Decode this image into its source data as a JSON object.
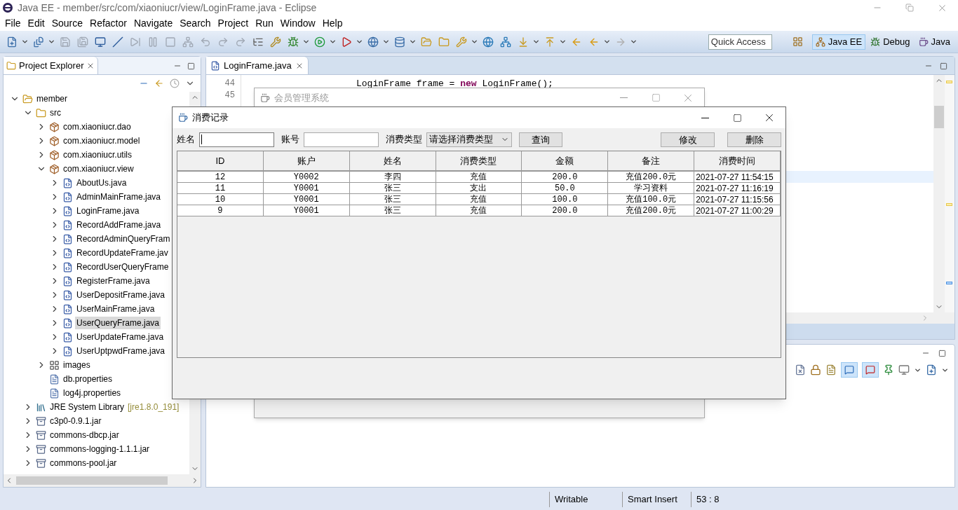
{
  "window": {
    "title": "Java EE - member/src/com/xiaoniucr/view/LoginFrame.java - Eclipse"
  },
  "menu": [
    "File",
    "Edit",
    "Source",
    "Refactor",
    "Navigate",
    "Search",
    "Project",
    "Run",
    "Window",
    "Help"
  ],
  "quick_access": {
    "placeholder": "Quick Access"
  },
  "perspectives": [
    {
      "label": "Java EE",
      "selected": true
    },
    {
      "label": "Debug",
      "selected": false
    },
    {
      "label": "Java",
      "selected": false
    }
  ],
  "project_explorer": {
    "title": "Project Explorer",
    "tree": [
      {
        "label": "member",
        "kind": "project",
        "expanded": true,
        "selected": false,
        "children": [
          {
            "label": "src",
            "kind": "source",
            "expanded": true,
            "selected": false,
            "children": [
              {
                "label": "com.xiaoniucr.dao",
                "kind": "package",
                "expanded": false,
                "selected": false
              },
              {
                "label": "com.xiaoniucr.model",
                "kind": "package",
                "expanded": false,
                "selected": false
              },
              {
                "label": "com.xiaoniucr.utils",
                "kind": "package",
                "expanded": false,
                "selected": false
              },
              {
                "label": "com.xiaoniucr.view",
                "kind": "package",
                "expanded": true,
                "selected": false,
                "children": [
                  {
                    "label": "AboutUs.java",
                    "kind": "java",
                    "expanded": false,
                    "selected": false
                  },
                  {
                    "label": "AdminMainFrame.java",
                    "kind": "java",
                    "expanded": false,
                    "selected": false
                  },
                  {
                    "label": "LoginFrame.java",
                    "kind": "java",
                    "expanded": false,
                    "selected": false
                  },
                  {
                    "label": "RecordAddFrame.java",
                    "kind": "java",
                    "expanded": false,
                    "selected": false
                  },
                  {
                    "label": "RecordAdminQueryFram",
                    "kind": "java",
                    "expanded": false,
                    "selected": false
                  },
                  {
                    "label": "RecordUpdateFrame.jav",
                    "kind": "java",
                    "expanded": false,
                    "selected": false
                  },
                  {
                    "label": "RecordUserQueryFrame",
                    "kind": "java",
                    "expanded": false,
                    "selected": false
                  },
                  {
                    "label": "RegisterFrame.java",
                    "kind": "java",
                    "expanded": false,
                    "selected": false
                  },
                  {
                    "label": "UserDepositFrame.java",
                    "kind": "java",
                    "expanded": false,
                    "selected": false
                  },
                  {
                    "label": "UserMainFrame.java",
                    "kind": "java",
                    "expanded": false,
                    "selected": false
                  },
                  {
                    "label": "UserQueryFrame.java",
                    "kind": "java",
                    "expanded": false,
                    "selected": true
                  },
                  {
                    "label": "UserUpdateFrame.java",
                    "kind": "java",
                    "expanded": false,
                    "selected": false
                  },
                  {
                    "label": "UserUptpwdFrame.java",
                    "kind": "java",
                    "expanded": false,
                    "selected": false
                  }
                ]
              },
              {
                "label": "images",
                "kind": "folder",
                "expanded": false,
                "selected": false
              },
              {
                "label": "db.properties",
                "kind": "properties",
                "selected": false
              },
              {
                "label": "log4j.properties",
                "kind": "properties",
                "selected": false
              }
            ]
          },
          {
            "label": "JRE System Library",
            "decoration": "[jre1.8.0_191]",
            "kind": "library",
            "expanded": false,
            "selected": false
          },
          {
            "label": "c3p0-0.9.1.jar",
            "kind": "jar",
            "expanded": false,
            "selected": false
          },
          {
            "label": "commons-dbcp.jar",
            "kind": "jar",
            "expanded": false,
            "selected": false
          },
          {
            "label": "commons-logging-1.1.1.jar",
            "kind": "jar",
            "expanded": false,
            "selected": false
          },
          {
            "label": "commons-pool.jar",
            "kind": "jar",
            "expanded": false,
            "selected": false
          }
        ]
      }
    ]
  },
  "editor": {
    "tab": "LoginFrame.java",
    "lines": [
      {
        "number": "44",
        "tokens": [
          {
            "text": "LoginFrame frame = ",
            "kind": "plain"
          },
          {
            "text": "new",
            "kind": "keyword"
          },
          {
            "text": " LoginFrame();",
            "kind": "plain"
          }
        ]
      },
      {
        "number": "45"
      }
    ]
  },
  "back_window": {
    "title": "会员管理系统"
  },
  "dialog": {
    "title": "消费记录",
    "filters": [
      {
        "label": "姓名",
        "kind": "text",
        "focused": true
      },
      {
        "label": "账号",
        "kind": "text",
        "focused": false
      },
      {
        "label": "消费类型",
        "kind": "select",
        "value": "请选择消费类型"
      }
    ],
    "query_button": "查询",
    "action_buttons": [
      "修改",
      "删除"
    ],
    "table": {
      "columns": [
        "ID",
        "账户",
        "姓名",
        "消费类型",
        "金额",
        "备注",
        "消费时间"
      ],
      "rows": [
        [
          "12",
          "Y0002",
          "李四",
          "充值",
          "200.0",
          "充值200.0元",
          "2021-07-27 11:54:15"
        ],
        [
          "11",
          "Y0001",
          "张三",
          "支出",
          "50.0",
          "学习资料",
          "2021-07-27 11:16:19"
        ],
        [
          "10",
          "Y0001",
          "张三",
          "充值",
          "100.0",
          "充值100.0元",
          "2021-07-27 11:15:56"
        ],
        [
          "9",
          "Y0001",
          "张三",
          "充值",
          "200.0",
          "充值200.0元",
          "2021-07-27 11:00:29"
        ]
      ]
    }
  },
  "status_bar": [
    "Writable",
    "Smart Insert",
    "53 : 8"
  ]
}
